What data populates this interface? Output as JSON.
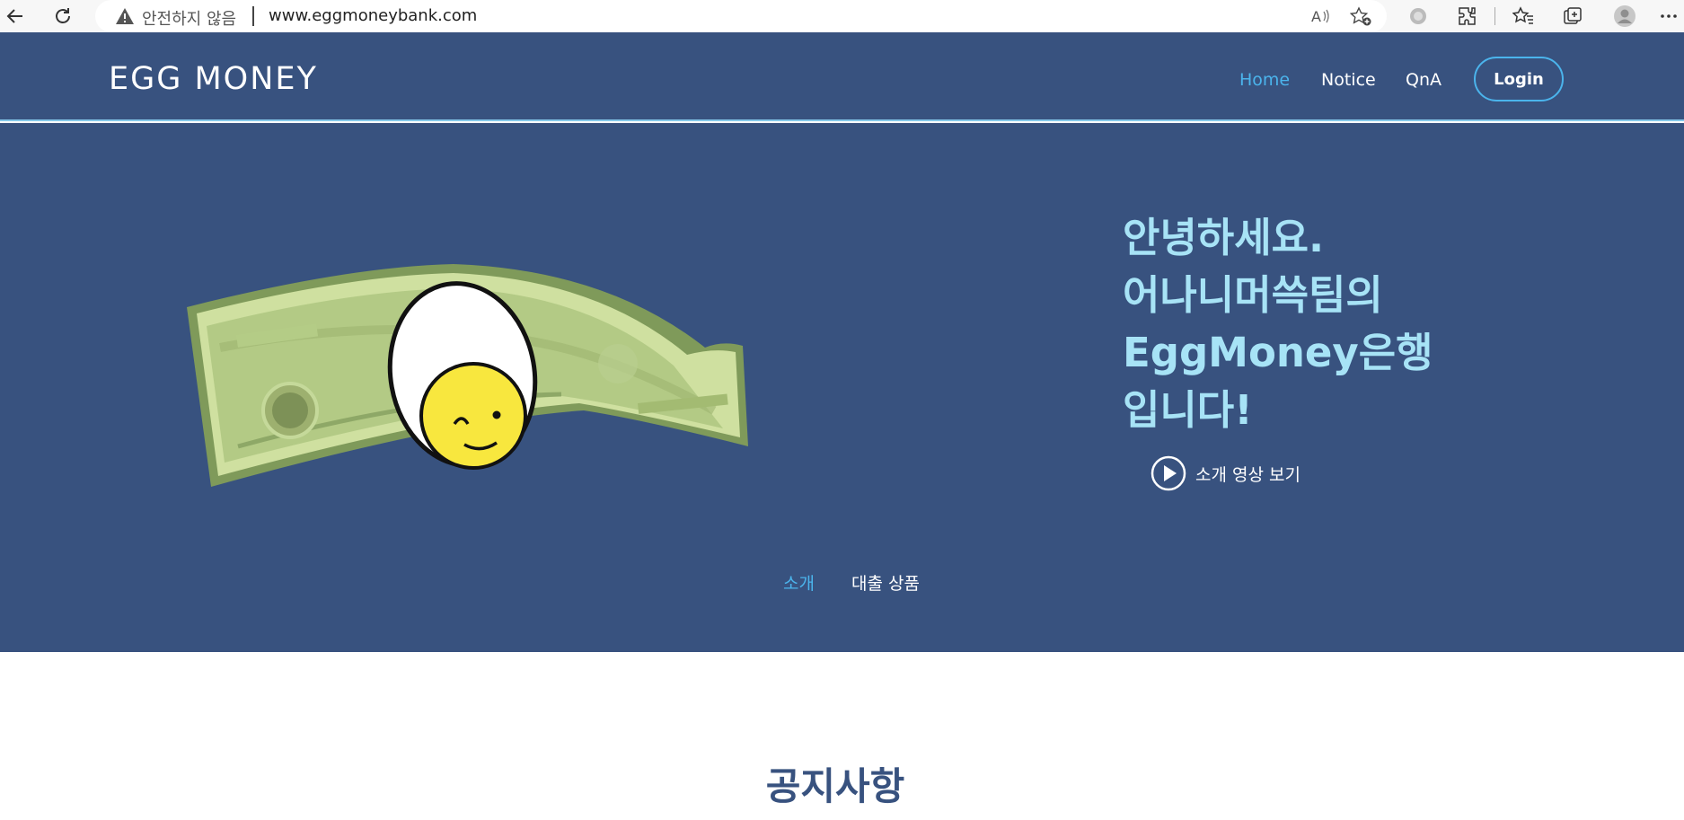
{
  "browser": {
    "security_label": "안전하지 않음",
    "url": "www.eggmoneybank.com"
  },
  "header": {
    "logo": "EGG MONEY",
    "nav": [
      {
        "label": "Home",
        "active": true
      },
      {
        "label": "Notice",
        "active": false
      },
      {
        "label": "QnA",
        "active": false
      }
    ],
    "login_label": "Login"
  },
  "hero": {
    "heading_lines": [
      "안녕하세요.",
      "어나니머쓱팀의",
      "EggMoney은행",
      "입니다!"
    ],
    "video_label": "소개 영상 보기",
    "tabs": [
      {
        "label": "소개",
        "active": true
      },
      {
        "label": "대출 상품",
        "active": false
      }
    ],
    "illustration": "money-egg-illustration"
  },
  "notice": {
    "title": "공지사항"
  },
  "colors": {
    "header_bg": "#38527f",
    "accent": "#4bb4ec",
    "heading": "#a7e3f6",
    "notice_title": "#38527f"
  }
}
